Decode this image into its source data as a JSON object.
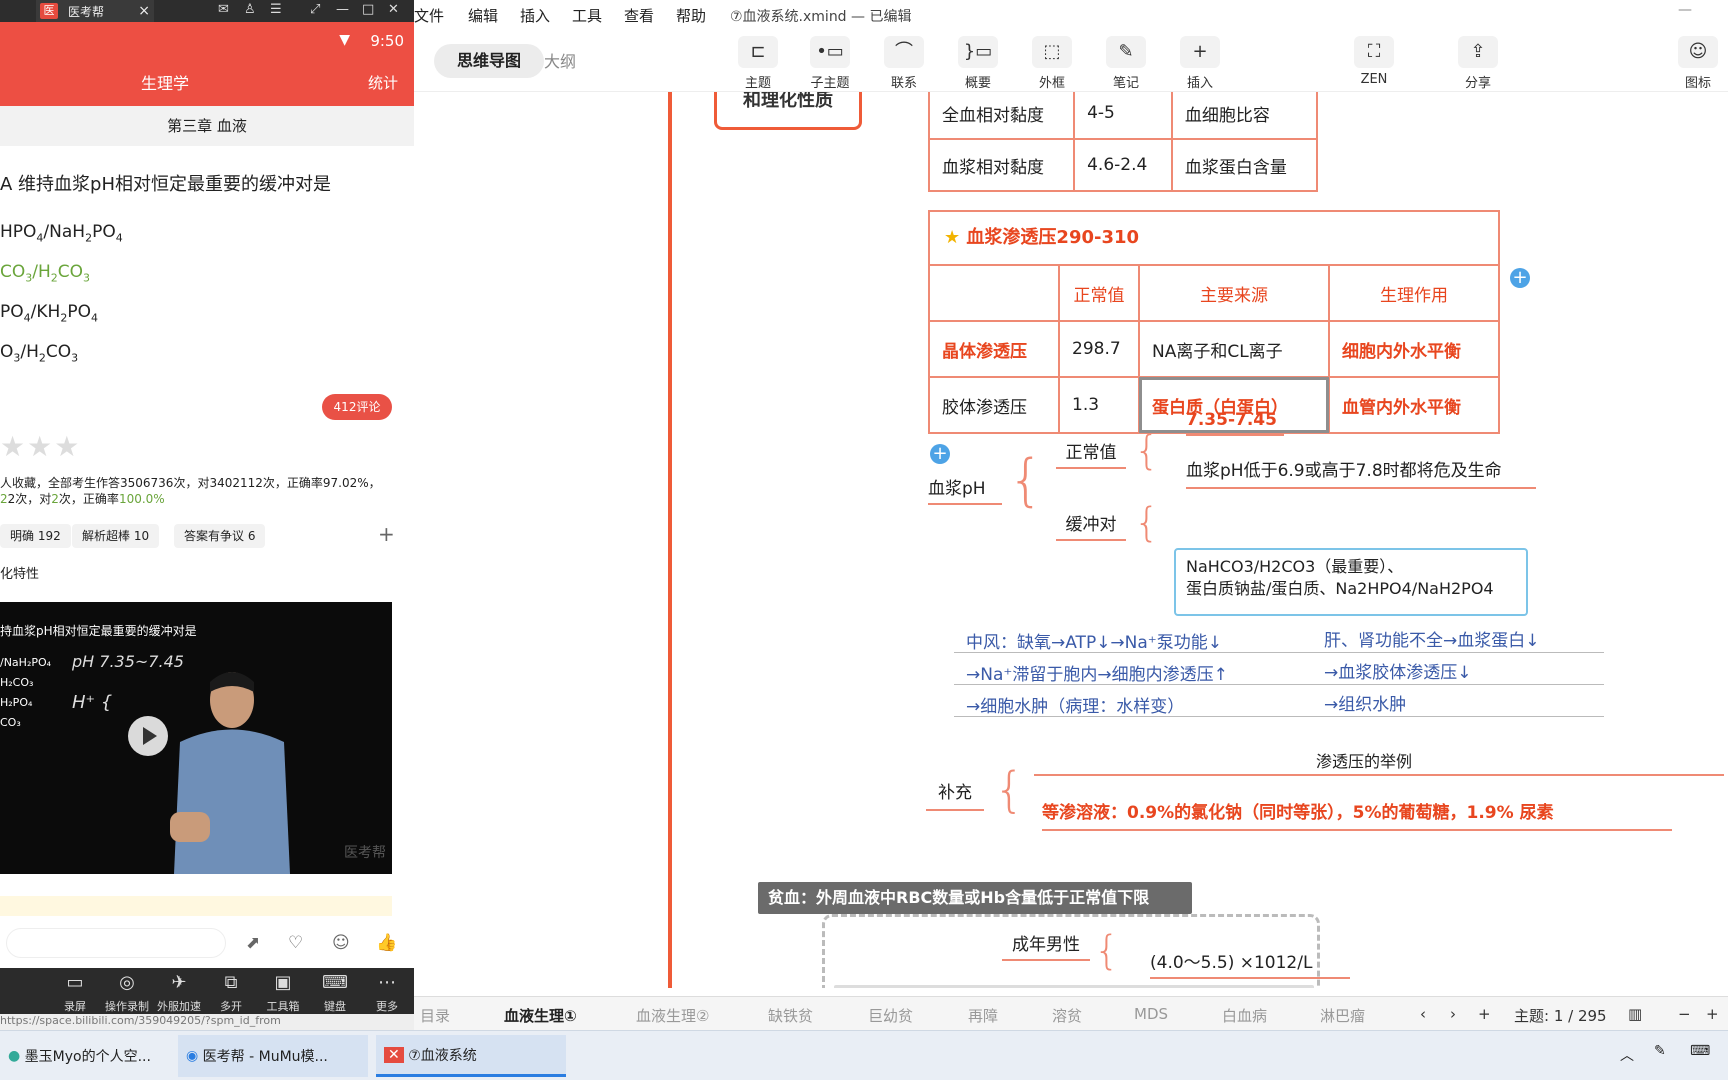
{
  "emulator": {
    "tab_title": "医考帮",
    "tab_logo": "医",
    "status_time": "9:50",
    "header_title": "生理学",
    "header_right": "统计",
    "chapter": "第三章 血液",
    "question": "A 维持血浆pH相对恒定最重要的缓冲对是",
    "options": [
      {
        "pre": "HPO",
        "s1": "4",
        "mid": "/NaH",
        "s2": "2",
        "mid2": "PO",
        "s3": "4"
      },
      {
        "pre": "CO",
        "s1": "3",
        "mid": "/H",
        "s2": "2",
        "mid2": "CO",
        "s3": "3"
      },
      {
        "pre": "PO",
        "s1": "4",
        "mid": "/KH",
        "s2": "2",
        "mid2": "PO",
        "s3": "4"
      },
      {
        "pre": "O",
        "s1": "3",
        "mid": "/H",
        "s2": "2",
        "mid2": "CO",
        "s3": "3"
      }
    ],
    "comments_btn": "412评论",
    "stars": "★★★",
    "stats_line1": "人收藏，全部考生作答3506736次，对3402112次，正确率97.02%，",
    "stats_line2_a": "2次，对",
    "stats_line2_b": "2",
    "stats_line2_c": "次，正确率",
    "stats_line2_d": "100.0%",
    "chips": [
      "明确 192",
      "解析超棒 10",
      "答案有争议 6"
    ],
    "chip_plus": "+",
    "tag": "化特性",
    "video": {
      "title": "持血浆pH相对恒定最重要的缓冲对是",
      "lines": [
        "/NaH₂PO₄",
        "H₂CO₃",
        "H₂PO₄",
        "CO₃"
      ],
      "board": "pH 7.35~7.45",
      "board2": "H⁺ {",
      "watermark": "医考帮"
    },
    "bottom_bar": [
      {
        "icon": "▭",
        "label": "录屏"
      },
      {
        "icon": "◎",
        "label": "操作录制"
      },
      {
        "icon": "✈",
        "label": "外服加速"
      },
      {
        "icon": "⧉",
        "label": "多开"
      },
      {
        "icon": "▣",
        "label": "工具箱"
      },
      {
        "icon": "⌨",
        "label": "键盘"
      },
      {
        "icon": "⋯",
        "label": "更多"
      }
    ],
    "url": "https://space.bilibili.com/359049205/?spm_id_from"
  },
  "xmind": {
    "menu": [
      "文件",
      "编辑",
      "插入",
      "工具",
      "查看",
      "帮助"
    ],
    "file_title": "⑦血液系统.xmind — 已编辑",
    "modes": [
      "思维导图",
      "大纲"
    ],
    "toolbar": [
      {
        "icon": "⊏",
        "label": "主题"
      },
      {
        "icon": "•▭",
        "label": "子主题"
      },
      {
        "icon": "⌒",
        "label": "联系"
      },
      {
        "icon": "}▭",
        "label": "概要"
      },
      {
        "icon": "⬚",
        "label": "外框"
      },
      {
        "icon": "✎",
        "label": "笔记"
      },
      {
        "icon": "+",
        "label": "插入"
      },
      {
        "icon": "⛶",
        "label": "ZEN"
      },
      {
        "icon": "⇪",
        "label": "分享"
      },
      {
        "icon": "☺",
        "label": "图标"
      }
    ],
    "top_node": "和理化性质",
    "viscosity_table": [
      [
        "全血相对黏度",
        "4-5",
        "血细胞比容"
      ],
      [
        "血浆相对黏度",
        "4.6-2.4",
        "血浆蛋白含量"
      ]
    ],
    "osm_title": "血浆渗透压290-310",
    "osm_headers": [
      "",
      "正常值",
      "主要来源",
      "生理作用"
    ],
    "osm_rows": [
      [
        "晶体渗透压",
        "298.7",
        "NA离子和CL离子",
        "细胞内外水平衡"
      ],
      [
        "胶体渗透压",
        "1.3",
        "蛋白质（白蛋白）",
        "血管内外水平衡"
      ]
    ],
    "ph_label": "血浆pH",
    "normal_label": "正常值",
    "normal_value": "7.35-7.45",
    "normal_note": "血浆pH低于6.9或高于7.8时都将危及生命",
    "buffer_label": "缓冲对",
    "buffer_line1": "NaHCO3/H2CO3（最重要）、",
    "buffer_line2": "蛋白质钠盐/蛋白质、Na2HPO4/NaH2PO4",
    "handnote": [
      "中风：缺氧→ATP↓→Na⁺泵功能↓",
      "肝、肾功能不全→血浆蛋白↓",
      "→Na⁺滞留于胞内→细胞内渗透压↑",
      "→血浆胶体渗透压↓",
      "→细胞水肿（病理：水样变）",
      "→组织水肿"
    ],
    "example_title": "渗透压的举例",
    "supplement_label": "补充",
    "isotonic": "等渗溶液：0.9%的氯化钠（同时等张），5%的葡萄糖，1.9% 尿素",
    "anemia_title": "贫血：外周血液中RBC数量或Hb含量低于正常值下限",
    "adult_male": "成年男性",
    "adult_male_value": "(4.0～5.5) ×1012/L",
    "sheets": [
      "目录",
      "血液生理①",
      "血液生理②",
      "缺铁贫",
      "巨幼贫",
      "再障",
      "溶贫",
      "MDS",
      "白血病",
      "淋巴瘤"
    ],
    "topic_count": "主题: 1 / 295"
  },
  "taskbar": [
    "墨玉Myo的个人空...",
    "医考帮 - MuMu模...",
    "⑦血液系统"
  ]
}
